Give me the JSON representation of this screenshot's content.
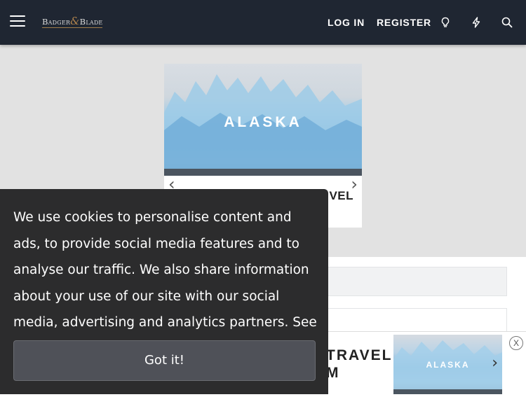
{
  "header": {
    "logo": {
      "left": "Badger",
      "amp": "&",
      "right": "Blade"
    },
    "login_label": "LOG IN",
    "register_label": "REGISTER"
  },
  "ad_top": {
    "image_text": "ALASKA",
    "caption_partial": "VEL",
    "prev_arrow": "‹",
    "next_arrow": "›"
  },
  "ad_bottom": {
    "text_line1": "TRAVEL",
    "text_line2": "M",
    "image_text": "ALASKA",
    "next_arrow": "›",
    "close_label": "X"
  },
  "cookie": {
    "message": "We use cookies to personalise content and ads, to provide social media features and to analyse our traffic. We also share information about your use of our site with our social media, advertising and analytics partners.",
    "details_link": "See details",
    "accept_label": "Got it!"
  },
  "colors": {
    "header_bg": "#1f2632",
    "page_bg": "#e2e2e2",
    "cookie_bg": "#2c2c2d",
    "cookie_button": "#4f5158",
    "logo_accent": "#b0834c"
  },
  "icons": [
    "menu-icon",
    "lightbulb-icon",
    "bolt-icon",
    "search-icon",
    "chevron-left-icon",
    "chevron-right-icon",
    "close-icon"
  ]
}
